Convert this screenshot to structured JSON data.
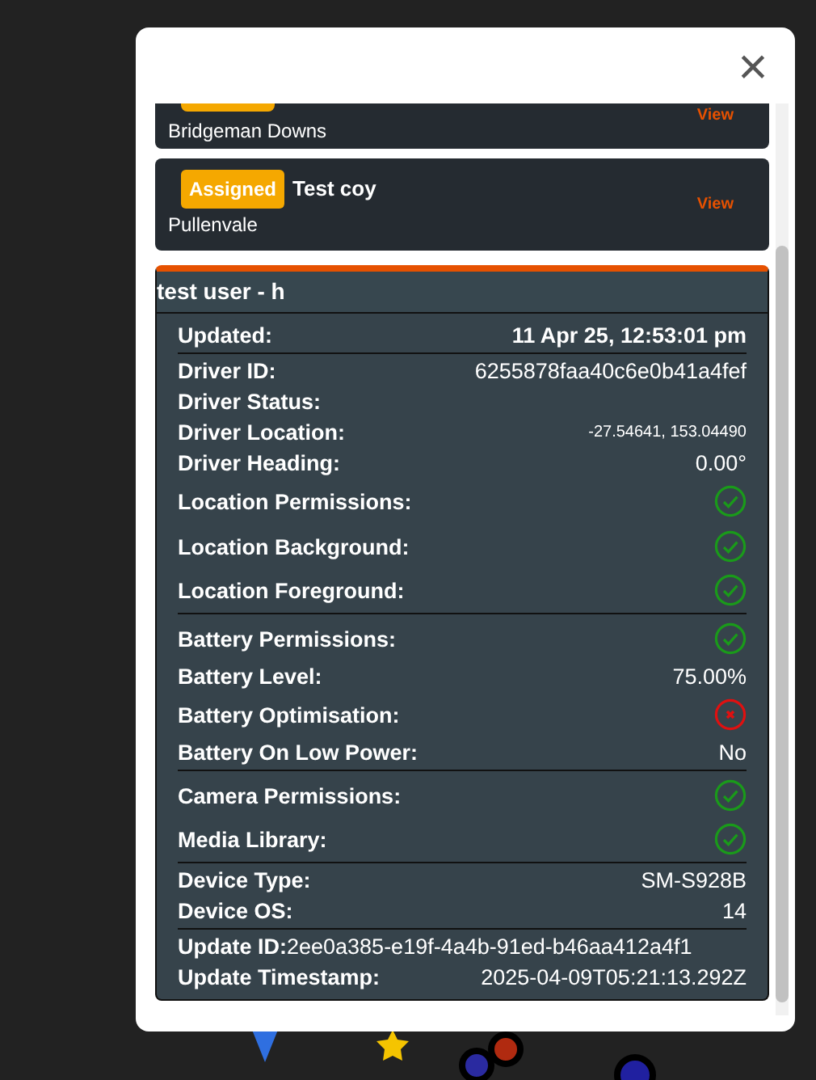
{
  "dialog": {
    "close_label": "×"
  },
  "jobs": [
    {
      "suburb": "Bridgeman Downs",
      "action": "View",
      "cut": true
    },
    {
      "status": "Assigned",
      "customer": "Test coy",
      "suburb": "Pullenvale",
      "action": "View",
      "cut": false
    }
  ],
  "driver_panel": {
    "title": "test user - h",
    "rows": [
      {
        "kind": "text",
        "label": "Updated:",
        "value": "11 Apr 25, 12:53:01 pm",
        "bold_value": true,
        "divider": true
      },
      {
        "kind": "text",
        "label": "Driver ID:",
        "value": "6255878faa40c6e0b41a4fef"
      },
      {
        "kind": "text",
        "label": "Driver Status:"
      },
      {
        "kind": "text",
        "label": "Driver Location:",
        "value": "-27.54641, 153.04490",
        "small": true
      },
      {
        "kind": "text",
        "label": "Driver Heading:",
        "value": "0.00°"
      },
      {
        "kind": "status",
        "label": "Location Permissions:",
        "ok": true
      },
      {
        "kind": "status",
        "label": "Location Background:",
        "ok": true
      },
      {
        "kind": "status",
        "label": "Location Foreground:",
        "ok": true,
        "divider": true
      },
      {
        "kind": "status",
        "label": "Battery Permissions:",
        "ok": true
      },
      {
        "kind": "text",
        "label": "Battery Level:",
        "value": "75.00%"
      },
      {
        "kind": "status",
        "label": "Battery Optimisation:",
        "ok": false
      },
      {
        "kind": "text",
        "label": "Battery On Low Power:",
        "value": "No",
        "divider": true
      },
      {
        "kind": "status",
        "label": "Camera Permissions:",
        "ok": true
      },
      {
        "kind": "status",
        "label": "Media Library:",
        "ok": true,
        "divider": true
      },
      {
        "kind": "text",
        "label": "Device Type:",
        "value": "SM-S928B"
      },
      {
        "kind": "text",
        "label": "Device OS:",
        "value": "14",
        "divider": true
      },
      {
        "kind": "inline",
        "label": "Update ID:",
        "value": "2ee0a385-e19f-4a4b-91ed-b46aa412a4f1"
      },
      {
        "kind": "text",
        "label": "Update Timestamp:",
        "value": "2025-04-09T05:21:13.292Z"
      }
    ]
  }
}
